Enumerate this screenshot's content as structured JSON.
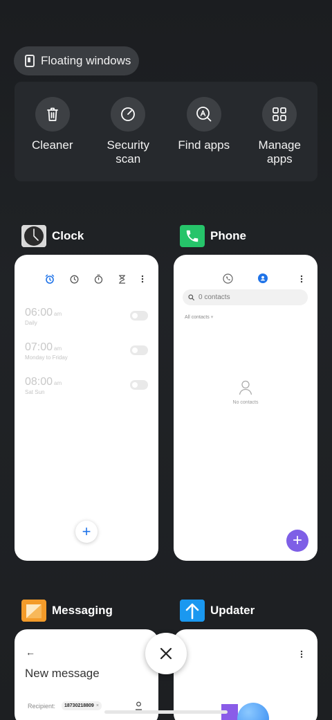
{
  "floating_windows": {
    "label": "Floating windows"
  },
  "actions": [
    {
      "label": "Cleaner",
      "icon": "trash-icon"
    },
    {
      "label": "Security\nscan",
      "icon": "security-scan-icon"
    },
    {
      "label": "Find apps",
      "icon": "find-apps-icon"
    },
    {
      "label": "Manage\napps",
      "icon": "grid-icon"
    }
  ],
  "clock": {
    "title": "Clock",
    "alarms": [
      {
        "time": "06:00",
        "ampm": "am",
        "repeat": "Daily"
      },
      {
        "time": "07:00",
        "ampm": "am",
        "repeat": "Monday to Friday"
      },
      {
        "time": "08:00",
        "ampm": "am",
        "repeat": "Sat Sun"
      }
    ],
    "accent": "#1f73e8"
  },
  "phone": {
    "title": "Phone",
    "search_placeholder": "0 contacts",
    "filter": "All contacts",
    "empty_text": "No contacts",
    "accent": "#7e5fe6"
  },
  "messaging": {
    "title": "Messaging",
    "heading": "New message",
    "recipient_label": "Recipient:",
    "recipient_chip": "18730218809"
  },
  "updater": {
    "title": "Updater"
  }
}
